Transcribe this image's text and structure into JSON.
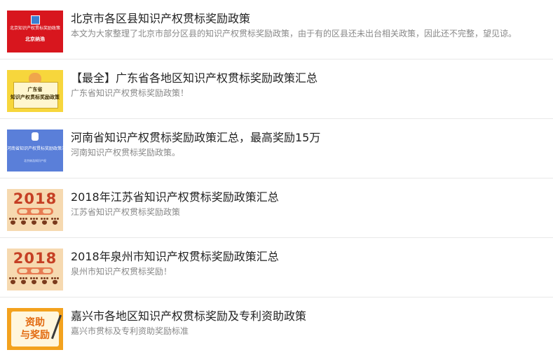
{
  "items": [
    {
      "title": "北京市各区县知识产权贯标奖励政策",
      "desc": "本文为大家整理了北京市部分区县的知识产权贯标奖励政策，由于有的区县还未出台相关政策，因此还不完整，望见谅。",
      "thumb": {
        "line1": "北京知识产权贯标奖励政策",
        "line2": "北京纳浩"
      }
    },
    {
      "title": "【最全】广东省各地区知识产权贯标奖励政策汇总",
      "desc": "广东省知识产权贯标奖励政策！",
      "thumb": {
        "line1": "广东省",
        "line2": "知识产权贯标奖励政策"
      }
    },
    {
      "title": "河南省知识产权贯标奖励政策汇总，最高奖励15万",
      "desc": "河南知识产权贯标奖励政策。",
      "thumb": {
        "line1": "河南省知识产权贯标奖励政策汇总",
        "line2": "北京纳浩知识产权"
      }
    },
    {
      "title": "2018年江苏省知识产权贯标奖励政策汇总",
      "desc": "江苏省知识产权贯标奖励政策",
      "thumb": {
        "line1": "2018"
      }
    },
    {
      "title": "2018年泉州市知识产权贯标奖励政策汇总",
      "desc": "泉州市知识产权贯标奖励！",
      "thumb": {
        "line1": "2018"
      }
    },
    {
      "title": "嘉兴市各地区知识产权贯标奖励及专利资助政策",
      "desc": "嘉兴市贯标及专利资助奖励标准",
      "thumb": {
        "line1": "资助",
        "line2": "与奖励"
      }
    }
  ]
}
